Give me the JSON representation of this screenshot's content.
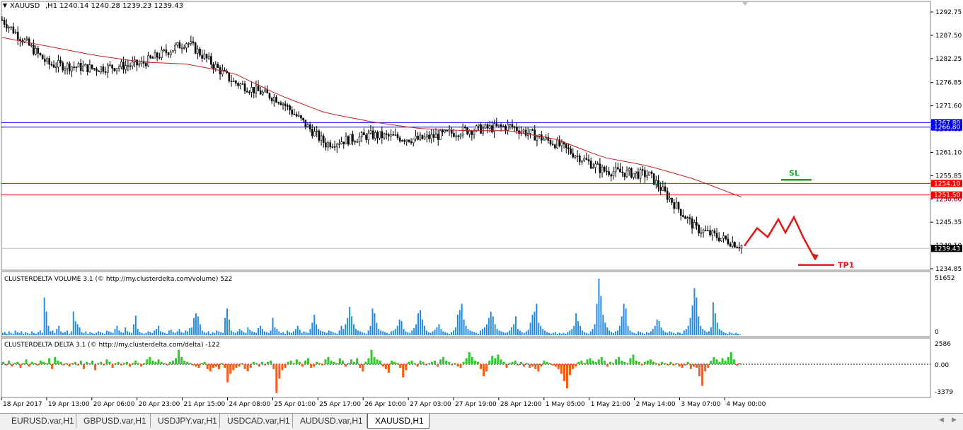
{
  "header": {
    "symbol": "XAUUSD",
    "timeframe": ",H1",
    "ohlc": "1240.14 1240.28 1239.23 1239.43"
  },
  "price_axis": {
    "ticks": [
      "1292.75",
      "1287.50",
      "1282.25",
      "1276.85",
      "1271.60",
      "1266.35",
      "1261.10",
      "1255.85",
      "1250.60",
      "1245.35",
      "1240.10",
      "1234.85"
    ]
  },
  "levels": [
    {
      "name": "upper-blue-line",
      "label": "1267.80",
      "color": "#0000ff"
    },
    {
      "name": "lower-blue-line",
      "label": "1266.80",
      "color": "#0000ff"
    },
    {
      "name": "upper-red-line",
      "label": "1254.10",
      "color": "#ff0000"
    },
    {
      "name": "lower-red-line",
      "label": "1251.50",
      "color": "#ff0000"
    },
    {
      "name": "current-price",
      "label": "1239.43",
      "color": "#000000"
    }
  ],
  "annotations": {
    "sl": "SL",
    "tp1": "TP1",
    "sl_color": "#1e9e28",
    "tp_color": "#e81414"
  },
  "volume_panel": {
    "title": "CLUSTERDELTA VOLUME 3.1 (© http://my.clusterdelta.com/volume) 522",
    "max_label": "51652",
    "min_label": "0",
    "color": "#1e88e5"
  },
  "delta_panel": {
    "title": "CLUSTERDELTA DELTA 3.1 (© http://my.clusterdelta.com/delta) -122",
    "top_label": "2586",
    "mid_label": "0.00",
    "bottom_label": "-3379",
    "pos_color": "#32c832",
    "neg_color": "#ff5a14"
  },
  "time_axis": [
    "18 Apr 2017",
    "19 Apr 13:00",
    "20 Apr 06:00",
    "20 Apr 23:00",
    "21 Apr 15:00",
    "24 Apr 08:00",
    "25 Apr 01:00",
    "25 Apr 17:00",
    "26 Apr 10:00",
    "27 Apr 03:00",
    "27 Apr 19:00",
    "28 Apr 12:00",
    "1 May 05:00",
    "1 May 21:00",
    "2 May 14:00",
    "3 May 07:00",
    "4 May 00:00"
  ],
  "tabs": [
    "EURUSD.var,H1",
    "GBPUSD.var,H1",
    "USDJPY.var,H1",
    "USDCAD.var,H1",
    "AUDUSD.var,H1",
    "XAUUSD,H1"
  ],
  "active_tab": 5,
  "chart_data": {
    "type": "line",
    "x": [
      "18 Apr 2017",
      "19 Apr 13:00",
      "20 Apr 06:00",
      "20 Apr 23:00",
      "21 Apr 15:00",
      "24 Apr 08:00",
      "25 Apr 01:00",
      "25 Apr 17:00",
      "26 Apr 10:00",
      "27 Apr 03:00",
      "27 Apr 19:00",
      "28 Apr 12:00",
      "1 May 05:00",
      "1 May 21:00",
      "2 May 14:00",
      "3 May 07:00",
      "4 May 00:00"
    ],
    "series": [
      {
        "values": [
          1291,
          1281,
          1280,
          1281,
          1286,
          1277,
          1273,
          1263,
          1265,
          1264,
          1266,
          1267,
          1263,
          1257,
          1256,
          1244,
          1240
        ]
      },
      {
        "values": [
          1287,
          1285,
          1283,
          1281.5,
          1281,
          1279,
          1274,
          1270,
          1268,
          1266.5,
          1266,
          1266,
          1264,
          1260,
          1258,
          1255,
          1251
        ]
      }
    ],
    "projection": {
      "x": [
        1052,
        1070,
        1085,
        1100,
        1110,
        1122,
        1135,
        1152
      ],
      "y": [
        1240,
        1244,
        1242,
        1246,
        1243,
        1246.5,
        1242,
        1237
      ]
    },
    "volume": [
      3,
      4,
      2,
      5,
      3,
      2,
      6,
      4,
      3,
      5,
      2,
      4,
      3,
      2,
      5,
      3,
      2,
      4,
      6,
      3,
      48,
      30,
      12,
      5,
      6,
      3,
      8,
      12,
      5,
      3,
      4,
      6,
      2,
      5,
      30,
      18,
      14,
      10,
      4,
      3,
      5,
      2,
      4,
      3,
      2,
      3,
      5,
      4,
      3,
      2,
      6,
      5,
      4,
      3,
      8,
      12,
      6,
      4,
      3,
      10,
      5,
      4,
      3,
      14,
      25,
      8,
      4,
      3,
      2,
      3,
      5,
      4,
      3,
      6,
      8,
      12,
      5,
      4,
      3,
      2,
      6,
      7,
      4,
      3,
      5,
      8,
      4,
      3,
      6,
      5,
      9,
      10,
      22,
      28,
      24,
      14,
      6,
      4,
      3,
      5,
      2,
      4,
      3,
      6,
      5,
      4,
      3,
      22,
      34,
      20,
      6,
      4,
      3,
      5,
      8,
      6,
      4,
      3,
      10,
      7,
      5,
      4,
      3,
      9,
      12,
      8,
      5,
      4,
      3,
      6,
      22,
      10,
      8,
      5,
      3,
      4,
      2,
      6,
      4,
      3,
      5,
      8,
      12,
      7,
      3,
      5,
      4,
      3,
      8,
      16,
      26,
      14,
      8,
      6,
      5,
      4,
      3,
      6,
      5,
      4,
      3,
      2,
      6,
      12,
      8,
      14,
      22,
      36,
      24,
      14,
      8,
      6,
      5,
      4,
      3,
      2,
      6,
      12,
      34,
      28,
      16,
      8,
      6,
      5,
      4,
      3,
      2,
      5,
      6,
      8,
      12,
      20,
      18,
      8,
      5,
      4,
      3,
      6,
      9,
      14,
      28,
      32,
      20,
      12,
      6,
      4,
      3,
      5,
      7,
      10,
      14,
      8,
      5,
      4,
      3,
      2,
      4,
      6,
      10,
      26,
      32,
      40,
      20,
      12,
      8,
      6,
      5,
      4,
      3,
      2,
      6,
      8,
      10,
      14,
      22,
      30,
      24,
      14,
      8,
      6,
      5,
      4,
      3,
      4,
      6,
      10,
      14,
      24,
      8,
      6,
      4,
      3,
      5,
      7,
      16,
      26,
      30,
      40,
      16,
      12,
      8,
      6,
      4,
      3,
      2,
      3,
      4,
      2,
      3,
      2,
      3,
      2,
      4,
      6,
      8,
      12,
      28,
      18,
      12,
      6,
      4,
      3,
      2,
      5,
      8,
      14,
      40,
      72,
      50,
      26,
      16,
      10,
      6,
      4,
      3,
      5,
      6,
      12,
      24,
      40,
      34,
      12,
      6,
      4,
      3,
      2,
      5,
      4,
      3,
      2,
      4,
      3,
      5,
      8,
      12,
      20,
      18,
      10,
      6,
      4,
      3,
      5,
      4,
      3,
      2,
      4,
      3,
      2,
      6,
      8,
      12,
      22,
      38,
      60,
      48,
      24,
      12,
      8,
      6,
      4,
      5,
      10,
      42,
      28,
      16,
      8,
      6,
      4,
      3,
      2,
      4,
      3,
      2,
      3,
      2,
      1
    ],
    "delta": [
      0.2,
      -0.1,
      0.3,
      -0.2,
      0.1,
      0.2,
      -0.3,
      0.1,
      0.4,
      -0.2,
      0.2,
      0.1,
      -0.1,
      0.3,
      0.2,
      0.1,
      0.5,
      -0.4,
      0.6,
      0.3,
      0.2,
      -0.1,
      0.1,
      -0.2,
      0.1,
      0.2,
      -0.1,
      0.3,
      -0.4,
      0.2,
      0.1,
      0.3,
      -0.5,
      0.1,
      0.2,
      -0.1,
      0.4,
      0.2,
      -0.3,
      0.1,
      0.2,
      -0.1,
      0.1,
      0.2,
      -0.2,
      0.1,
      0.3,
      0.1,
      -0.2,
      0.1,
      0.4,
      0.6,
      0.3,
      0.2,
      0.4,
      0.2,
      0.1,
      -0.1,
      0.2,
      0.3,
      0.5,
      1.2,
      0.6,
      0.3,
      0.2,
      0.1,
      -0.1,
      -0.2,
      -0.3,
      0.1,
      0.2,
      -0.4,
      -0.6,
      -0.3,
      -0.2,
      -0.4,
      0.1,
      -0.3,
      -1.5,
      -0.8,
      -0.5,
      -0.3,
      -0.2,
      0.1,
      -0.4,
      -0.6,
      -0.3,
      0.2,
      0.1,
      -0.2,
      0.2,
      -0.1,
      0.2,
      0.3,
      -0.4,
      -2.4,
      -1.2,
      -0.5,
      -0.3,
      0.2,
      0.3,
      0.1,
      0.4,
      0.2,
      -0.2,
      0.3,
      0.5,
      -0.3,
      -0.2,
      0.2,
      0.1,
      -0.1,
      0.4,
      0.6,
      0.3,
      0.2,
      0.1,
      0.5,
      0.3,
      -0.2,
      0.1,
      0.4,
      0.2,
      0.5,
      -0.3,
      -0.6,
      0.2,
      0.5,
      1.2,
      0.6,
      0.4,
      0.3,
      -0.2,
      -0.4,
      -0.7,
      0.3,
      0.2,
      0.1,
      -0.3,
      -1.1,
      -0.5,
      0.2,
      0.3,
      0.1,
      -0.2,
      0.3,
      0.2,
      -0.1,
      0.1,
      0.2,
      0.3,
      -0.2,
      0.4,
      0.6,
      0.3,
      0.2,
      -0.1,
      0.1,
      -0.2,
      -0.3,
      0.2,
      0.5,
      1.0,
      0.6,
      0.3,
      0.2,
      -0.4,
      -1.0,
      -0.6,
      0.3,
      0.7,
      0.5,
      0.8,
      0.4,
      0.2,
      -0.3,
      0.1,
      0.2,
      0.3,
      -0.1,
      0.2,
      -0.2,
      0.1,
      -0.3,
      -0.2,
      -0.4,
      -0.6,
      -0.2,
      0.3,
      0.2,
      0.1,
      -0.1,
      -0.2,
      -0.4,
      -0.8,
      -1.4,
      -2.0,
      -0.9,
      -0.4,
      -0.2,
      0.2,
      0.3,
      0.1,
      0.4,
      0.5,
      0.3,
      0.2,
      0.4,
      0.6,
      0.3,
      -0.2,
      0.2,
      0.1,
      0.4,
      0.6,
      0.3,
      0.2,
      0.1,
      0.5,
      0.8,
      0.3,
      0.2,
      -0.1,
      0.2,
      0.3,
      0.4,
      0.2,
      0.1,
      -0.1,
      0.2,
      0.1,
      -0.1,
      0.2,
      -0.1,
      0.1,
      -0.2,
      -0.3,
      -0.1,
      0.2,
      -0.4,
      -0.2,
      -0.3,
      -1.0,
      -1.8,
      -0.6,
      -0.3,
      0.3,
      0.6,
      0.4,
      0.2,
      0.5,
      0.3,
      0.6,
      1.0,
      0.4,
      -0.1,
      0.1
    ]
  }
}
